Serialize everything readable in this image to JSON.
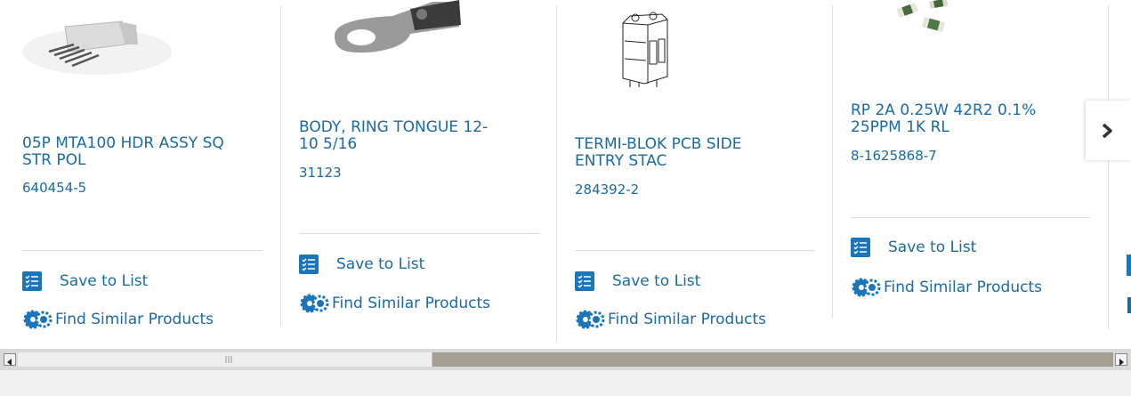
{
  "products": [
    {
      "title": "05P MTA100 HDR ASSY SQ\nSTR POL",
      "part_number": "640454-5",
      "image": "connector-header"
    },
    {
      "title": "BODY, RING TONGUE 12-\n10 5/16",
      "part_number": "31123",
      "image": "ring-terminal"
    },
    {
      "title": "TERMI-BLOK PCB SIDE\nENTRY STAC",
      "part_number": "284392-2",
      "image": "terminal-block"
    },
    {
      "title": "RP 2A 0.25W 42R2 0.1%\n25PPM 1K RL",
      "part_number": "8-1625868-7",
      "image": "resistor-chips"
    }
  ],
  "actions": {
    "save_label": "Save to List",
    "similar_label": "Find Similar Products"
  },
  "colors": {
    "link": "#1a6aa5",
    "icon_blue": "#1a75bb",
    "scroll_track": "#a59e93"
  },
  "icons": {
    "next": "chevron-right-icon",
    "save": "checklist-icon",
    "similar": "gears-icon"
  }
}
